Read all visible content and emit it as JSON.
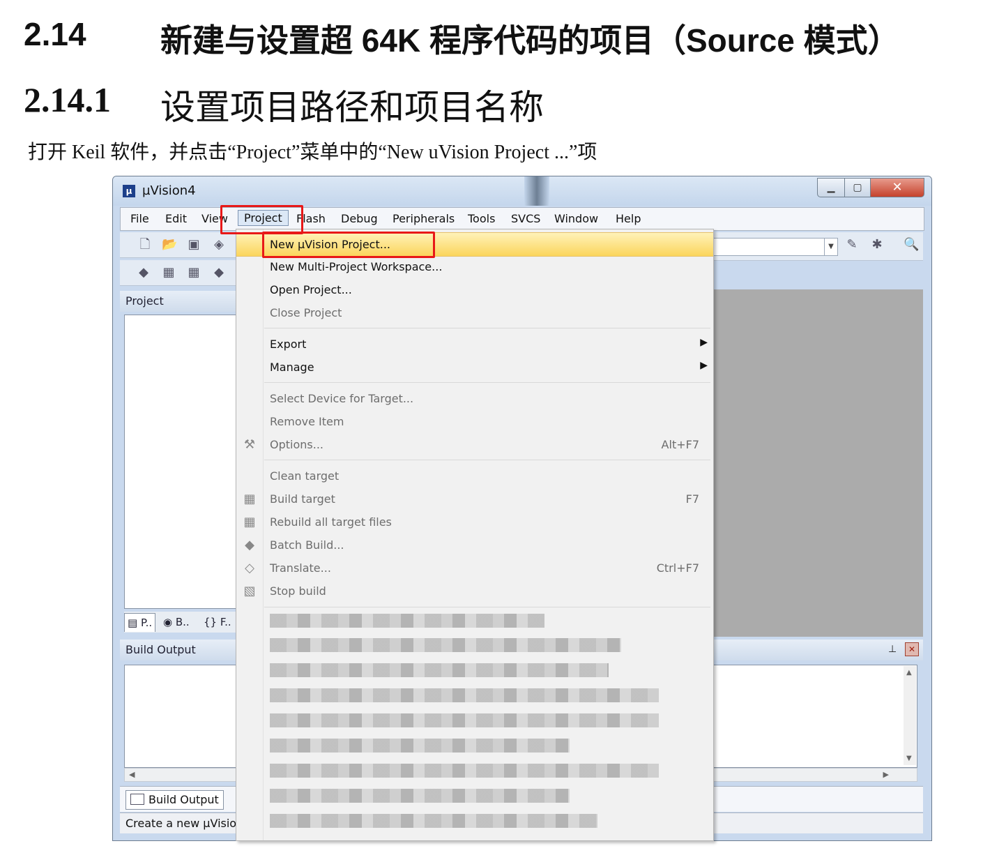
{
  "doc": {
    "section_num": "2.14",
    "section_title": "新建与设置超 64K 程序代码的项目（Source 模式）",
    "subsection_num": "2.14.1",
    "subsection_title": "设置项目路径和项目名称",
    "instruction": "打开 Keil 软件，并点击“Project”菜单中的“New uVision Project ...”项"
  },
  "window": {
    "title": "µVision4",
    "menu": [
      "File",
      "Edit",
      "View",
      "Project",
      "Flash",
      "Debug",
      "Peripherals",
      "Tools",
      "SVCS",
      "Window",
      "Help"
    ],
    "project_panel_title": "Project",
    "build_output_title": "Build Output",
    "project_tabs": [
      "P..",
      "B..",
      "{} F.."
    ],
    "bottom_tab": "Build Output",
    "status_text": "Create a new µVision"
  },
  "project_menu": {
    "items": [
      {
        "label": "New µVision Project...",
        "shortcut": "",
        "enabled": true,
        "highlighted": true
      },
      {
        "label": "New Multi-Project Workspace...",
        "shortcut": "",
        "enabled": true
      },
      {
        "label": "Open Project...",
        "shortcut": "",
        "enabled": true
      },
      {
        "label": "Close Project",
        "shortcut": "",
        "enabled": false
      },
      {
        "label": "Export",
        "shortcut": "",
        "enabled": true,
        "submenu": true
      },
      {
        "label": "Manage",
        "shortcut": "",
        "enabled": true,
        "submenu": true
      },
      {
        "label": "Select Device for Target...",
        "shortcut": "",
        "enabled": false
      },
      {
        "label": "Remove Item",
        "shortcut": "",
        "enabled": false
      },
      {
        "label": "Options...",
        "shortcut": "Alt+F7",
        "enabled": false,
        "icon": "options-icon"
      },
      {
        "label": "Clean target",
        "shortcut": "",
        "enabled": false
      },
      {
        "label": "Build target",
        "shortcut": "F7",
        "enabled": false,
        "icon": "build-icon"
      },
      {
        "label": "Rebuild all target files",
        "shortcut": "",
        "enabled": false,
        "icon": "rebuild-icon"
      },
      {
        "label": "Batch Build...",
        "shortcut": "",
        "enabled": false,
        "icon": "batch-build-icon"
      },
      {
        "label": "Translate...",
        "shortcut": "Ctrl+F7",
        "enabled": false,
        "icon": "translate-icon"
      },
      {
        "label": "Stop build",
        "shortcut": "",
        "enabled": false,
        "icon": "stop-build-icon"
      }
    ]
  },
  "colors": {
    "highlight_box": "#e81818",
    "menu_highlight": "#fbd55c"
  }
}
